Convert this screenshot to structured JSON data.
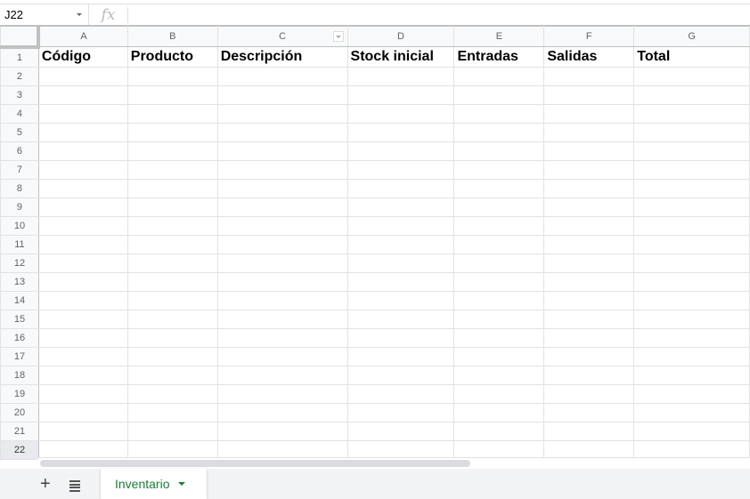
{
  "name_box": "J22",
  "formula_icon": "fx",
  "formula_value": "",
  "columns": [
    "A",
    "B",
    "C",
    "D",
    "E",
    "F",
    "G"
  ],
  "headers": [
    "Código",
    "Producto",
    "Descripción",
    "Stock inicial",
    "Entradas",
    "Salidas",
    "Total"
  ],
  "rows": [
    "1",
    "2",
    "3",
    "4",
    "5",
    "6",
    "7",
    "8",
    "9",
    "10",
    "11",
    "12",
    "13",
    "14",
    "15",
    "16",
    "17",
    "18",
    "19",
    "20",
    "21",
    "22"
  ],
  "selected_row": "22",
  "sheet_tabs": [
    {
      "label": "Inventario",
      "active": true
    }
  ],
  "add_sheet": "+",
  "colors": {
    "tab_active": "#188038"
  }
}
